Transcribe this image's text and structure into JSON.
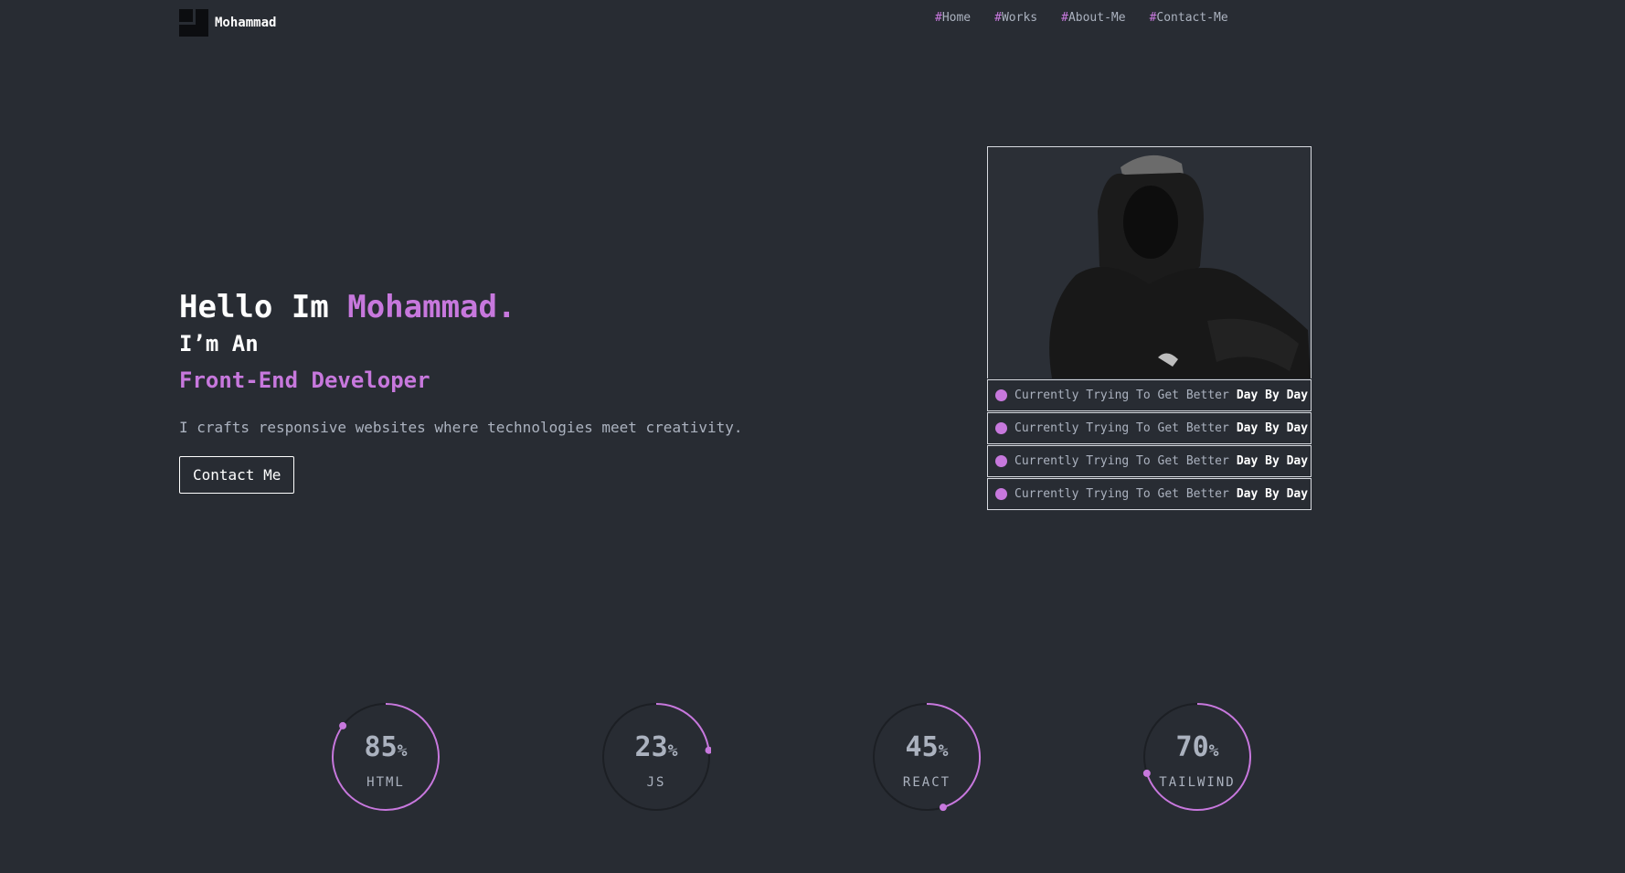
{
  "header": {
    "logo_text": "Mohammad",
    "nav": [
      {
        "hash": "#",
        "label": "Home"
      },
      {
        "hash": "#",
        "label": "Works"
      },
      {
        "hash": "#",
        "label": "About-Me"
      },
      {
        "hash": "#",
        "label": "Contact-Me"
      }
    ]
  },
  "hero": {
    "greeting": "Hello Im ",
    "name": "Mohammad.",
    "subtitle": "I’m An",
    "role": "Front-End Developer",
    "description": "I crafts responsive websites where technologies meet creativity.",
    "cta_label": "Contact Me"
  },
  "card": {
    "photo_icon": "hooded-person-photo",
    "statuses": [
      {
        "text": "Currently Trying To Get Better",
        "bold": "Day By Day"
      },
      {
        "text": "Currently Trying To Get Better",
        "bold": "Day By Day"
      },
      {
        "text": "Currently Trying To Get Better",
        "bold": "Day By Day"
      },
      {
        "text": "Currently Trying To Get Better",
        "bold": "Day By Day"
      }
    ]
  },
  "skills": [
    {
      "value": "85",
      "unit": "%",
      "name": "HTML",
      "fraction": 0.85
    },
    {
      "value": "23",
      "unit": "%",
      "name": "JS",
      "fraction": 0.23
    },
    {
      "value": "45",
      "unit": "%",
      "name": "REACT",
      "fraction": 0.45
    },
    {
      "value": "70",
      "unit": "%",
      "name": "TAILWIND",
      "fraction": 0.7
    }
  ],
  "colors": {
    "background": "#282c33",
    "accent": "#c778dd",
    "text_muted": "#abb2bf",
    "ring_track": "#1c1f24"
  }
}
